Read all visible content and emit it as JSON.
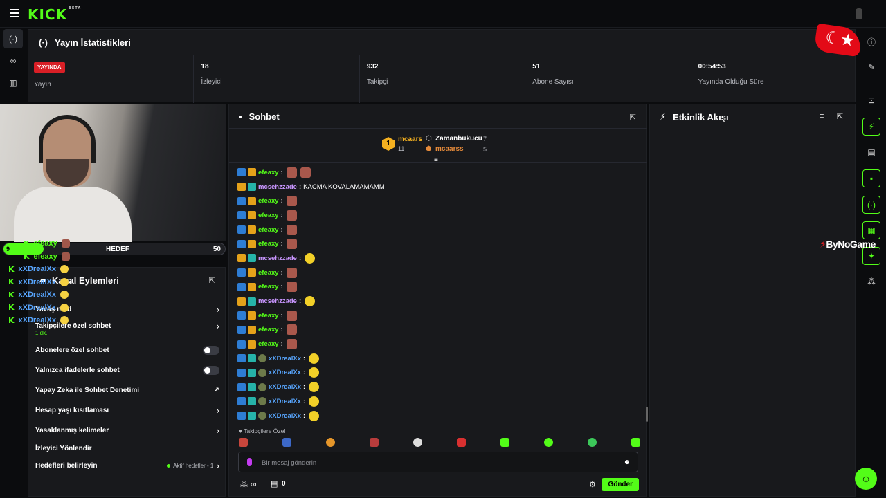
{
  "app": {
    "logo": "KICK",
    "beta": "BETA"
  },
  "stats": {
    "title": "Yayın İstatistikleri",
    "live_badge": "YAYINDA",
    "live_label": "Yayın",
    "cells": [
      {
        "value": "18",
        "label": "İzleyici"
      },
      {
        "value": "932",
        "label": "Takipçi"
      },
      {
        "value": "51",
        "label": "Abone Sayısı"
      },
      {
        "value": "00:54:53",
        "label": "Yayında Olduğu Süre"
      }
    ]
  },
  "goal": {
    "current": "9",
    "label": "HEDEF",
    "target": "50",
    "progress": 0.18
  },
  "overlay_chat": [
    {
      "name": "efeaxy"
    },
    {
      "name": "efeaxy"
    },
    {
      "name": "xXDrealXx"
    },
    {
      "name": "xXDrealXx"
    },
    {
      "name": "xXDrealXx"
    },
    {
      "name": "xXDrealXx"
    },
    {
      "name": "xXDrealXx"
    }
  ],
  "channel_actions": {
    "title": "Kanal Eylemleri",
    "items": [
      {
        "label": "Yavaş mod"
      },
      {
        "label": "Takipçilere özel sohbet",
        "sub": "1 dk."
      },
      {
        "label": "Abonelere özel sohbet"
      },
      {
        "label": "Yalnızca ifadelerle sohbet"
      },
      {
        "label": "Yapay Zeka ile Sohbet Denetimi"
      },
      {
        "label": "Hesap yaşı kısıtlaması"
      },
      {
        "label": "Yasaklanmış kelimeler"
      },
      {
        "label": "İzleyici Yönlendir"
      },
      {
        "label": "Hedefleri belirleyin",
        "status": "Aktif hedefler - 1"
      }
    ]
  },
  "chat": {
    "title": "Sohbet",
    "gifters": [
      {
        "rank": "1",
        "name": "mcaars",
        "count": "11"
      },
      {
        "name": "Zamanbukucu",
        "count": "7"
      },
      {
        "name": "mcaarss",
        "count": "5"
      }
    ],
    "messages": [
      {
        "user": "efeaxy",
        "text": "",
        "type": "a"
      },
      {
        "user": "mcsehzzade",
        "text": "KACMA KOVALAMAMAMM",
        "type": "b"
      },
      {
        "user": "efeaxy",
        "text": "",
        "type": "a"
      },
      {
        "user": "efeaxy",
        "text": "",
        "type": "a"
      },
      {
        "user": "efeaxy",
        "text": "",
        "type": "a"
      },
      {
        "user": "efeaxy",
        "text": "",
        "type": "a"
      },
      {
        "user": "mcsehzzade",
        "text": "",
        "type": "b"
      },
      {
        "user": "efeaxy",
        "text": "",
        "type": "a"
      },
      {
        "user": "efeaxy",
        "text": "",
        "type": "a"
      },
      {
        "user": "mcsehzzade",
        "text": "",
        "type": "b"
      },
      {
        "user": "efeaxy",
        "text": "",
        "type": "a"
      },
      {
        "user": "efeaxy",
        "text": "",
        "type": "a"
      },
      {
        "user": "efeaxy",
        "text": "",
        "type": "a"
      },
      {
        "user": "xXDrealXx",
        "text": "",
        "type": "c"
      },
      {
        "user": "xXDrealXx",
        "text": "",
        "type": "c"
      },
      {
        "user": "xXDrealXx",
        "text": "",
        "type": "c"
      },
      {
        "user": "xXDrealXx",
        "text": "",
        "type": "c"
      },
      {
        "user": "xXDrealXx",
        "text": "",
        "type": "c"
      }
    ],
    "followers_only": "Takipçilere Özel",
    "input_placeholder": "Bir mesaj gönderin",
    "infinity": "∞",
    "points": "0",
    "send": "Gönder"
  },
  "feed": {
    "title": "Etkinlik Akışı"
  },
  "sponsor": {
    "by": "By",
    "brand": "NoGame"
  },
  "colors": {
    "accent": "#53fc18",
    "live": "#d91f26",
    "panel": "#18191c"
  }
}
